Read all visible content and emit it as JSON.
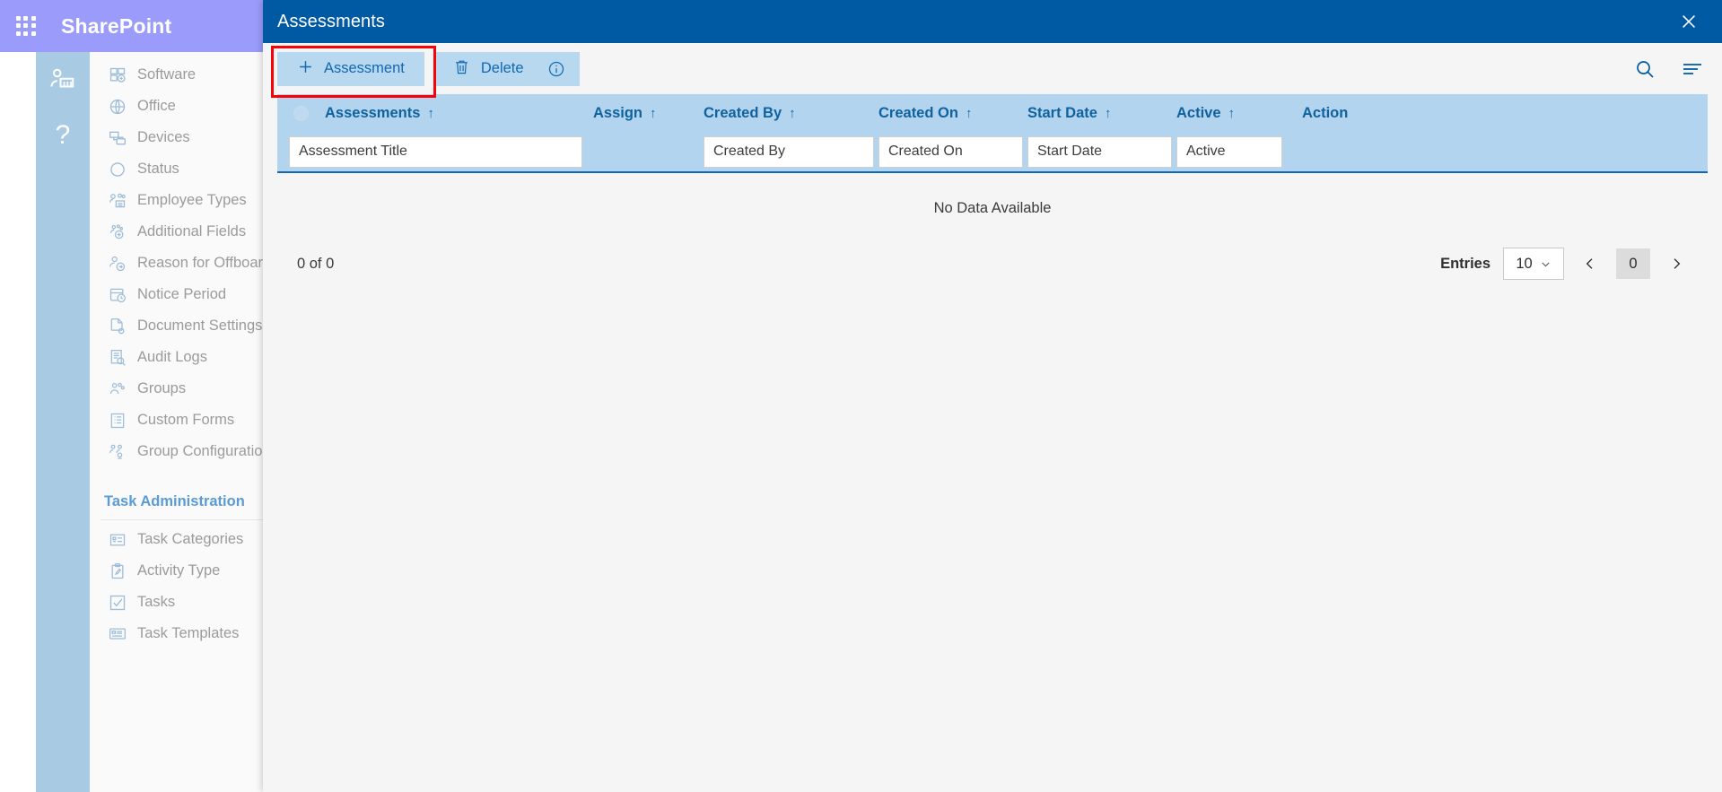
{
  "sharepoint": {
    "brand": "SharePoint",
    "waffle_icon": "app-launcher-icon",
    "rail": [
      {
        "icon": "org-user-icon",
        "label": ""
      },
      {
        "icon": "help-icon",
        "label": "?"
      }
    ],
    "nav": {
      "items": [
        {
          "label": "Software",
          "icon": "software-icon"
        },
        {
          "label": "Office",
          "icon": "globe-icon"
        },
        {
          "label": "Devices",
          "icon": "devices-icon"
        },
        {
          "label": "Status",
          "icon": "circle-icon"
        },
        {
          "label": "Employee Types",
          "icon": "employee-types-icon"
        },
        {
          "label": "Additional Fields",
          "icon": "additional-fields-icon"
        },
        {
          "label": "Reason for Offboard",
          "icon": "offboard-icon"
        },
        {
          "label": "Notice Period",
          "icon": "notice-period-icon"
        },
        {
          "label": "Document Settings",
          "icon": "document-settings-icon"
        },
        {
          "label": "Audit Logs",
          "icon": "audit-logs-icon"
        },
        {
          "label": "Groups",
          "icon": "groups-icon"
        },
        {
          "label": "Custom Forms",
          "icon": "custom-forms-icon"
        },
        {
          "label": "Group Configuration",
          "icon": "group-configuration-icon"
        }
      ],
      "section_title": "Task Administration",
      "task_items": [
        {
          "label": "Task Categories",
          "icon": "task-categories-icon"
        },
        {
          "label": "Activity Type",
          "icon": "activity-type-icon"
        },
        {
          "label": "Tasks",
          "icon": "tasks-icon"
        },
        {
          "label": "Task Templates",
          "icon": "task-templates-icon"
        }
      ]
    }
  },
  "panel": {
    "title": "Assessments",
    "close_icon": "close-icon",
    "toolbar": {
      "add_label": "Assessment",
      "add_icon": "plus-icon",
      "delete_label": "Delete",
      "delete_icon": "trash-icon",
      "info_icon": "info-icon",
      "search_icon": "search-icon",
      "filter_icon": "filter-lines-icon",
      "highlight_color": "#fb0007"
    },
    "grid": {
      "select_all_icon": "radio-unchecked-icon",
      "sort_arrow": "↑",
      "columns": [
        {
          "label": "Assessments",
          "sortable": true
        },
        {
          "label": "Assign",
          "sortable": true
        },
        {
          "label": "Created By",
          "sortable": true
        },
        {
          "label": "Created On",
          "sortable": true
        },
        {
          "label": "Start Date",
          "sortable": true
        },
        {
          "label": "Active",
          "sortable": true
        },
        {
          "label": "Action",
          "sortable": false
        }
      ],
      "filters": [
        {
          "name": "assessment-title-filter",
          "placeholder": "Assessment Title",
          "value": ""
        },
        {
          "name": "assign-filter",
          "placeholder": "",
          "value": ""
        },
        {
          "name": "created-by-filter",
          "placeholder": "Created By",
          "value": ""
        },
        {
          "name": "created-on-filter",
          "placeholder": "Created On",
          "value": ""
        },
        {
          "name": "start-date-filter",
          "placeholder": "Start Date",
          "value": ""
        },
        {
          "name": "active-filter",
          "placeholder": "Active",
          "value": ""
        }
      ],
      "empty_message": "No Data Available",
      "count_label": "0 of 0",
      "entries_label": "Entries",
      "entries_value": "10",
      "prev_icon": "chevron-left-icon",
      "next_icon": "chevron-right-icon",
      "current_page": "0"
    }
  },
  "colors": {
    "topbar": "#9a9bfb",
    "panel_header": "#0059a3",
    "grid_header": "#b2d4ef",
    "button": "#b8d8ef",
    "accent": "#1268b3"
  }
}
